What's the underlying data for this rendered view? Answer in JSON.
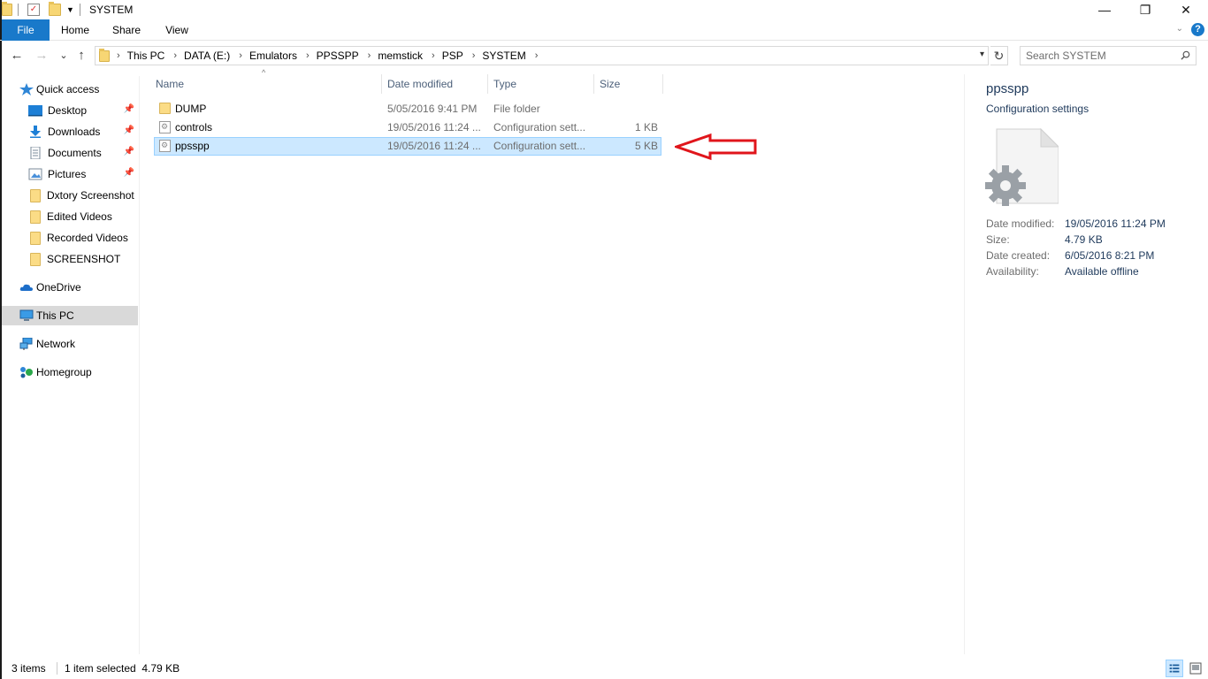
{
  "window": {
    "title": "SYSTEM",
    "controls": {
      "minimize": "—",
      "restore": "❐",
      "close": "✕"
    }
  },
  "ribbon": {
    "tabs": [
      "File",
      "Home",
      "Share",
      "View"
    ],
    "help": "?"
  },
  "nav": {
    "back": "←",
    "forward": "→",
    "recent": "⌄",
    "up": "↑",
    "refresh": "↻"
  },
  "address": {
    "crumbs": [
      "This PC",
      "DATA (E:)",
      "Emulators",
      "PPSSPP",
      "memstick",
      "PSP",
      "SYSTEM"
    ]
  },
  "search": {
    "placeholder": "Search SYSTEM"
  },
  "sidebar": {
    "items": [
      {
        "label": "Quick access",
        "icon": "star-icon",
        "pinned": false
      },
      {
        "label": "Desktop",
        "icon": "desktop-icon",
        "pinned": true
      },
      {
        "label": "Downloads",
        "icon": "download-icon",
        "pinned": true
      },
      {
        "label": "Documents",
        "icon": "documents-icon",
        "pinned": true
      },
      {
        "label": "Pictures",
        "icon": "pictures-icon",
        "pinned": true
      },
      {
        "label": "Dxtory Screenshot",
        "icon": "folder-icon",
        "pinned": false
      },
      {
        "label": "Edited Videos",
        "icon": "folder-icon",
        "pinned": false
      },
      {
        "label": "Recorded Videos",
        "icon": "folder-icon",
        "pinned": false
      },
      {
        "label": "SCREENSHOT",
        "icon": "folder-icon",
        "pinned": false
      },
      {
        "label": "OneDrive",
        "icon": "onedrive-icon",
        "pinned": false
      },
      {
        "label": "This PC",
        "icon": "this-pc-icon",
        "pinned": false,
        "selected": true
      },
      {
        "label": "Network",
        "icon": "network-icon",
        "pinned": false
      },
      {
        "label": "Homegroup",
        "icon": "homegroup-icon",
        "pinned": false
      }
    ]
  },
  "filelist": {
    "columns": [
      "Name",
      "Date modified",
      "Type",
      "Size"
    ],
    "rows": [
      {
        "name": "DUMP",
        "date": "5/05/2016 9:41 PM",
        "type": "File folder",
        "size": "",
        "icon": "folder-icon"
      },
      {
        "name": "controls",
        "date": "19/05/2016 11:24 ...",
        "type": "Configuration sett...",
        "size": "1 KB",
        "icon": "config-file-icon"
      },
      {
        "name": "ppsspp",
        "date": "19/05/2016 11:24 ...",
        "type": "Configuration sett...",
        "size": "5 KB",
        "icon": "config-file-icon",
        "selected": true
      }
    ]
  },
  "details": {
    "title": "ppsspp",
    "subtitle": "Configuration settings",
    "props": [
      {
        "label": "Date modified:",
        "value": "19/05/2016 11:24 PM"
      },
      {
        "label": "Size:",
        "value": "4.79 KB"
      },
      {
        "label": "Date created:",
        "value": "6/05/2016 8:21 PM"
      },
      {
        "label": "Availability:",
        "value": "Available offline"
      }
    ]
  },
  "status": {
    "count": "3 items",
    "selection": "1 item selected  4.79 KB"
  },
  "colors": {
    "accent": "#1979ca",
    "selection_bg": "#cce8ff",
    "selection_border": "#99d1ff",
    "annotation_arrow": "#e0151b"
  }
}
